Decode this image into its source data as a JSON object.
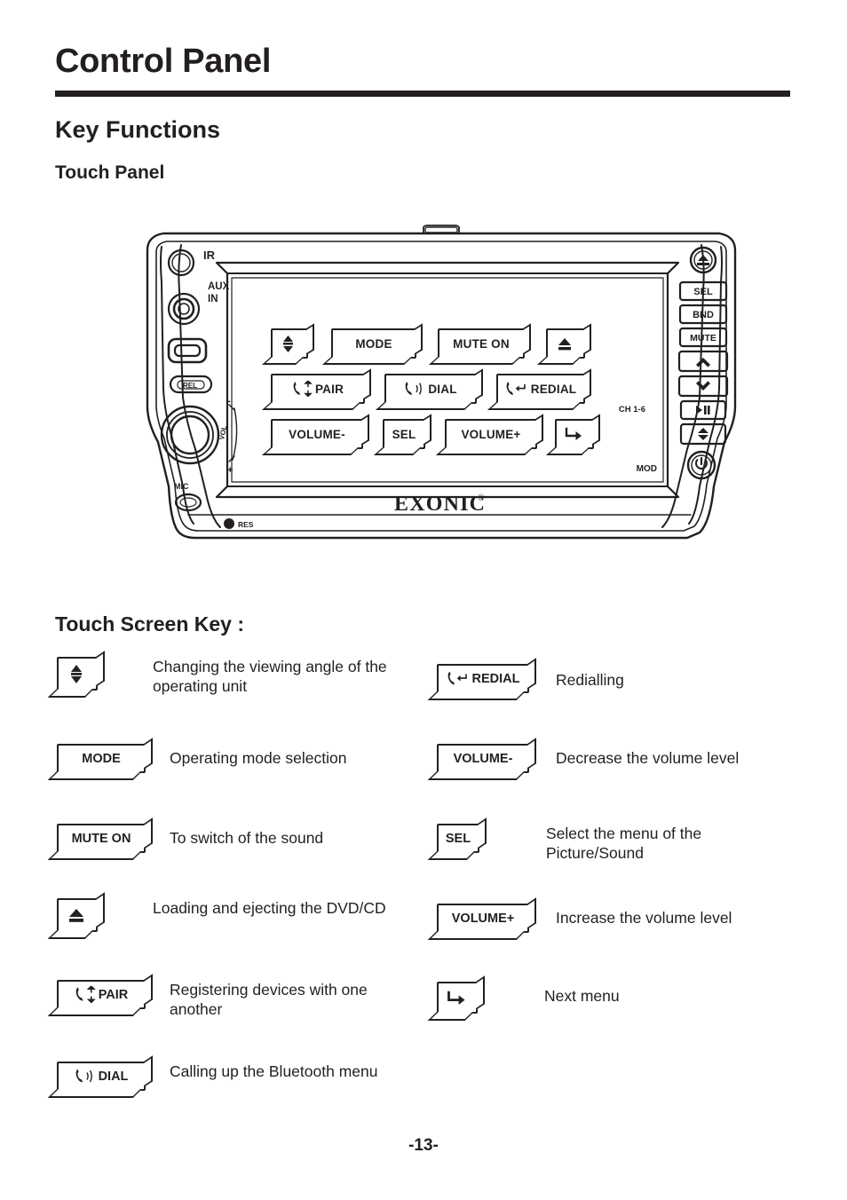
{
  "header": {
    "title": "Control Panel",
    "section": "Key Functions",
    "subsection": "Touch Panel",
    "legend_heading": "Touch Screen Key :"
  },
  "device": {
    "brand": "EXONIC",
    "brand_mark": "®",
    "left_labels": {
      "ir": "IR",
      "aux_in_line1": "AUX",
      "aux_in_line2": "IN",
      "rel": "REL",
      "vol": "VOL",
      "vol_minus": "-",
      "vol_plus": "+",
      "mic": "MIC",
      "res": "RES"
    },
    "right_labels": {
      "sel": "SEL",
      "bnd": "BND",
      "mute": "MUTE",
      "ch": "CH 1-6",
      "mod": "MOD"
    },
    "touch_buttons": [
      {
        "name": "angle",
        "label": "",
        "icon": "up-down-arrows-icon"
      },
      {
        "name": "mode",
        "label": "MODE",
        "icon": ""
      },
      {
        "name": "mute-on",
        "label": "MUTE ON",
        "icon": ""
      },
      {
        "name": "eject",
        "label": "",
        "icon": "eject-icon"
      },
      {
        "name": "pair",
        "label": "PAIR",
        "icon": "phone-pair-icon"
      },
      {
        "name": "dial",
        "label": "DIAL",
        "icon": "phone-dial-icon"
      },
      {
        "name": "redial",
        "label": "REDIAL",
        "icon": "phone-redial-icon"
      },
      {
        "name": "volume-down",
        "label": "VOLUME-",
        "icon": ""
      },
      {
        "name": "sel",
        "label": "SEL",
        "icon": ""
      },
      {
        "name": "volume-up",
        "label": "VOLUME+",
        "icon": ""
      },
      {
        "name": "next-menu",
        "label": "",
        "icon": "next-menu-arrow-icon"
      }
    ]
  },
  "legend": {
    "left": [
      {
        "key_label": "",
        "key_icon": "up-down-arrows-icon",
        "desc": "Changing the viewing angle of the operating unit"
      },
      {
        "key_label": "MODE",
        "key_icon": "",
        "desc": "Operating mode selection"
      },
      {
        "key_label": "MUTE ON",
        "key_icon": "",
        "desc": "To switch of the sound"
      },
      {
        "key_label": "",
        "key_icon": "eject-icon",
        "desc": "Loading and ejecting the DVD/CD"
      },
      {
        "key_label": "PAIR",
        "key_icon": "phone-pair-icon",
        "desc": "Registering devices with one another"
      },
      {
        "key_label": "DIAL",
        "key_icon": "phone-dial-icon",
        "desc": "Calling up the Bluetooth menu"
      }
    ],
    "right": [
      {
        "key_label": "REDIAL",
        "key_icon": "phone-redial-icon",
        "desc": "Redialling"
      },
      {
        "key_label": "VOLUME-",
        "key_icon": "",
        "desc": "Decrease the volume level"
      },
      {
        "key_label": "SEL",
        "key_icon": "",
        "desc": "Select the menu of the Picture/Sound"
      },
      {
        "key_label": "VOLUME+",
        "key_icon": "",
        "desc": "Increase the volume level"
      },
      {
        "key_label": "",
        "key_icon": "next-menu-arrow-icon",
        "desc": "Next menu"
      }
    ]
  },
  "footer": {
    "page_number": "-13-"
  },
  "colors": {
    "ink": "#231f20",
    "paper": "#ffffff"
  }
}
